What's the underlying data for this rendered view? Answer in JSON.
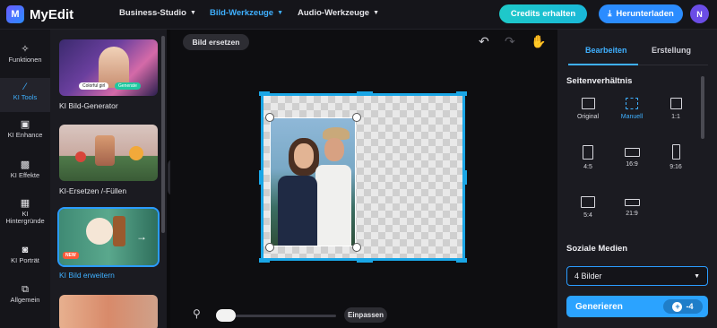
{
  "app": {
    "name": "MyEdit",
    "logo_letter": "M"
  },
  "nav": [
    {
      "label": "Business-Studio",
      "active": false
    },
    {
      "label": "Bild-Werkzeuge",
      "active": true
    },
    {
      "label": "Audio-Werkzeuge",
      "active": false
    }
  ],
  "header": {
    "credits_label": "Credits erhalten",
    "download_label": "Herunterladen",
    "avatar_letter": "N"
  },
  "rail": [
    {
      "label": "Funktionen",
      "icon": "sparkle-icon",
      "glyph": "✧"
    },
    {
      "label": "KI Tools",
      "icon": "magic-wand-icon",
      "glyph": "⚚",
      "active": true
    },
    {
      "label": "KI Enhance",
      "icon": "image-enhance-icon",
      "glyph": "▣"
    },
    {
      "label": "KI Effekte",
      "icon": "effects-icon",
      "glyph": "▩"
    },
    {
      "label": "KI Hintergründe",
      "icon": "background-icon",
      "glyph": "▦"
    },
    {
      "label": "KI Porträt",
      "icon": "portrait-icon",
      "glyph": "◙"
    },
    {
      "label": "Allgemein",
      "icon": "crop-icon",
      "glyph": "⧉"
    }
  ],
  "tools": [
    {
      "label": "KI Bild-Generator",
      "thumb_tags": [
        "Colorful girl",
        "Generate"
      ]
    },
    {
      "label": "KI-Ersetzen /-Füllen"
    },
    {
      "label": "KI Bild erweitern",
      "active": true,
      "badge": "NEW"
    },
    {
      "label": ""
    }
  ],
  "canvas": {
    "replace_label": "Bild ersetzen",
    "fit_label": "Einpassen",
    "zoom": 0
  },
  "rightpanel": {
    "tabs": [
      "Bearbeiten",
      "Erstellung"
    ],
    "aspect_title": "Seitenverhältnis",
    "ratios": [
      "Original",
      "Manuell",
      "1:1",
      "4:5",
      "16:9",
      "9:16",
      "5:4",
      "21:9"
    ],
    "social_title": "Soziale Medien",
    "select_value": "4 Bilder",
    "generate_label": "Generieren",
    "credit_cost": "-4"
  },
  "colors": {
    "accent": "#2b9cff",
    "brand_teal": "#1ec9c9",
    "background": "#0e0e11"
  }
}
